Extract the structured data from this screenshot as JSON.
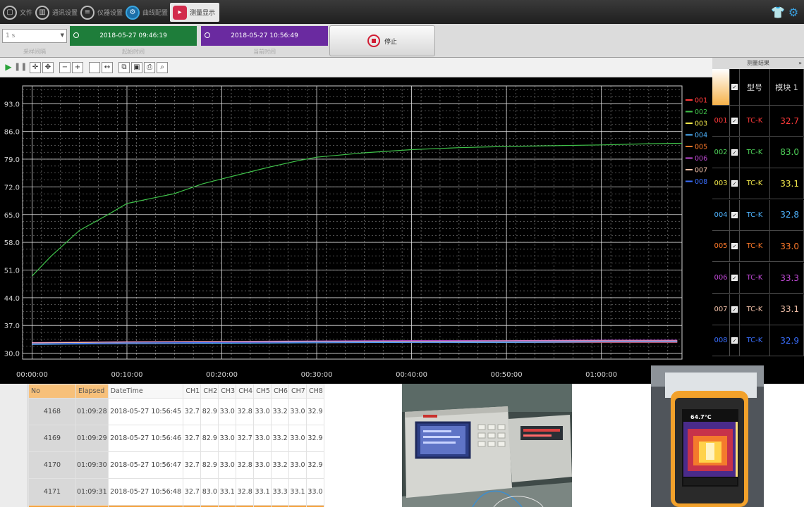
{
  "nav": {
    "items": [
      {
        "label": "文件",
        "icon": "file-icon"
      },
      {
        "label": "通讯设置",
        "icon": "comm-settings-icon"
      },
      {
        "label": "仪器设置",
        "icon": "instrument-settings-icon"
      },
      {
        "label": "曲线配置",
        "icon": "curve-config-icon"
      },
      {
        "label": "测量显示",
        "icon": "measure-display-icon"
      }
    ],
    "right_icons": [
      "shirt-icon",
      "gear-icon"
    ]
  },
  "status": {
    "interval_value": "1 s",
    "interval_caption": "采样间隔",
    "start_time": "2018-05-27 09:46:19",
    "start_caption": "起始时间",
    "current_time": "2018-05-27 10:56:49",
    "current_caption": "当前时间",
    "stop_label": "停止",
    "colors": {
      "start_box": "#1e7d3a",
      "current_box": "#6a2aa0",
      "stop_icon": "#d11d34"
    }
  },
  "toolbar": {
    "buttons": [
      "play-icon",
      "pause-icon",
      "crosshair-icon",
      "pan-icon",
      "zoom-out-icon",
      "zoom-in-icon",
      "blank-box-icon",
      "fit-horizontal-icon",
      "copy-icon",
      "save-icon",
      "print-icon",
      "print-preview-icon"
    ]
  },
  "chart_data": {
    "type": "line",
    "title": "",
    "xlabel": "",
    "ylabel": "",
    "x_ticks": [
      "00:00:00",
      "00:10:00",
      "00:20:00",
      "00:30:00",
      "00:40:00",
      "00:50:00",
      "01:00:00"
    ],
    "y_ticks": [
      "30.0",
      "37.0",
      "44.0",
      "51.0",
      "58.0",
      "65.0",
      "72.0",
      "79.0",
      "86.0",
      "93.0"
    ],
    "xlim_minutes": [
      -1,
      68.5
    ],
    "ylim": [
      28.5,
      97.5
    ],
    "grid": true,
    "legend_position": "right",
    "series": [
      {
        "name": "001",
        "color": "#ff3a3a",
        "x": [
          0,
          10,
          20,
          30,
          40,
          50,
          60,
          68
        ],
        "y": [
          32.3,
          32.5,
          32.6,
          32.6,
          32.7,
          32.7,
          32.7,
          32.7
        ]
      },
      {
        "name": "002",
        "color": "#3fc24a",
        "x": [
          0,
          2,
          5,
          8,
          10,
          13,
          15,
          18,
          20,
          23,
          25,
          28,
          30,
          35,
          40,
          45,
          50,
          55,
          60,
          65,
          68.5
        ],
        "y": [
          49.5,
          54.5,
          61,
          65,
          67.8,
          69.3,
          70.3,
          72.8,
          74,
          75.8,
          77,
          78.6,
          79.5,
          80.6,
          81.4,
          81.9,
          82.2,
          82.4,
          82.6,
          82.9,
          83.0
        ]
      },
      {
        "name": "003",
        "color": "#f2e84b",
        "x": [
          0,
          10,
          20,
          30,
          40,
          50,
          60,
          68
        ],
        "y": [
          32.6,
          32.8,
          32.9,
          33.0,
          33.0,
          33.1,
          33.1,
          33.1
        ]
      },
      {
        "name": "004",
        "color": "#4fb4ff",
        "x": [
          0,
          10,
          20,
          30,
          40,
          50,
          60,
          68
        ],
        "y": [
          32.2,
          32.4,
          32.5,
          32.6,
          32.7,
          32.7,
          32.8,
          32.8
        ]
      },
      {
        "name": "005",
        "color": "#ff7a2a",
        "x": [
          0,
          10,
          20,
          30,
          40,
          50,
          60,
          68
        ],
        "y": [
          32.6,
          32.8,
          32.9,
          33.0,
          33.0,
          33.0,
          33.0,
          33.0
        ]
      },
      {
        "name": "006",
        "color": "#c24ad8",
        "x": [
          0,
          10,
          20,
          30,
          40,
          50,
          60,
          68
        ],
        "y": [
          32.7,
          32.9,
          33.0,
          33.1,
          33.2,
          33.2,
          33.3,
          33.3
        ]
      },
      {
        "name": "007",
        "color": "#f2c0a8",
        "x": [
          0,
          10,
          20,
          30,
          40,
          50,
          60,
          68
        ],
        "y": [
          32.6,
          32.8,
          32.9,
          33.0,
          33.0,
          33.1,
          33.1,
          33.1
        ]
      },
      {
        "name": "008",
        "color": "#3a6fff",
        "x": [
          0,
          10,
          20,
          30,
          40,
          50,
          60,
          68
        ],
        "y": [
          32.4,
          32.6,
          32.7,
          32.8,
          32.8,
          32.9,
          32.9,
          32.9
        ]
      }
    ]
  },
  "panel": {
    "title": "测量结果",
    "headers": {
      "type": "型号",
      "module": "模块 1"
    },
    "rows": [
      {
        "ch": "001",
        "type": "TC-K",
        "value": "32.7",
        "color": "#ff3a3a"
      },
      {
        "ch": "002",
        "type": "TC-K",
        "value": "83.0",
        "color": "#4fd35a"
      },
      {
        "ch": "003",
        "type": "TC-K",
        "value": "33.1",
        "color": "#f2e84b"
      },
      {
        "ch": "004",
        "type": "TC-K",
        "value": "32.8",
        "color": "#4fb4ff"
      },
      {
        "ch": "005",
        "type": "TC-K",
        "value": "33.0",
        "color": "#ff7a2a"
      },
      {
        "ch": "006",
        "type": "TC-K",
        "value": "33.3",
        "color": "#c24ad8"
      },
      {
        "ch": "007",
        "type": "TC-K",
        "value": "33.1",
        "color": "#f2c0a8"
      },
      {
        "ch": "008",
        "type": "TC-K",
        "value": "32.9",
        "color": "#3a6fff"
      }
    ]
  },
  "table": {
    "headers": [
      "No",
      "Elapsed",
      "DateTime",
      "CH1",
      "CH2",
      "CH3",
      "CH4",
      "CH5",
      "CH6",
      "CH7",
      "CH8"
    ],
    "rows": [
      [
        "4168",
        "01:09:28",
        "2018-05-27 10:56:45",
        "32.7",
        "82.9",
        "33.0",
        "32.8",
        "33.0",
        "33.2",
        "33.0",
        "32.9"
      ],
      [
        "4169",
        "01:09:29",
        "2018-05-27 10:56:46",
        "32.7",
        "82.9",
        "33.0",
        "32.7",
        "33.0",
        "33.2",
        "33.0",
        "32.9"
      ],
      [
        "4170",
        "01:09:30",
        "2018-05-27 10:56:47",
        "32.7",
        "82.9",
        "33.0",
        "32.8",
        "33.0",
        "33.2",
        "33.0",
        "32.9"
      ],
      [
        "4171",
        "01:09:31",
        "2018-05-27 10:56:48",
        "32.7",
        "83.0",
        "33.1",
        "32.8",
        "33.1",
        "33.3",
        "33.1",
        "33.0"
      ]
    ]
  },
  "photos": {
    "thermal_reading": "64.7°C"
  }
}
